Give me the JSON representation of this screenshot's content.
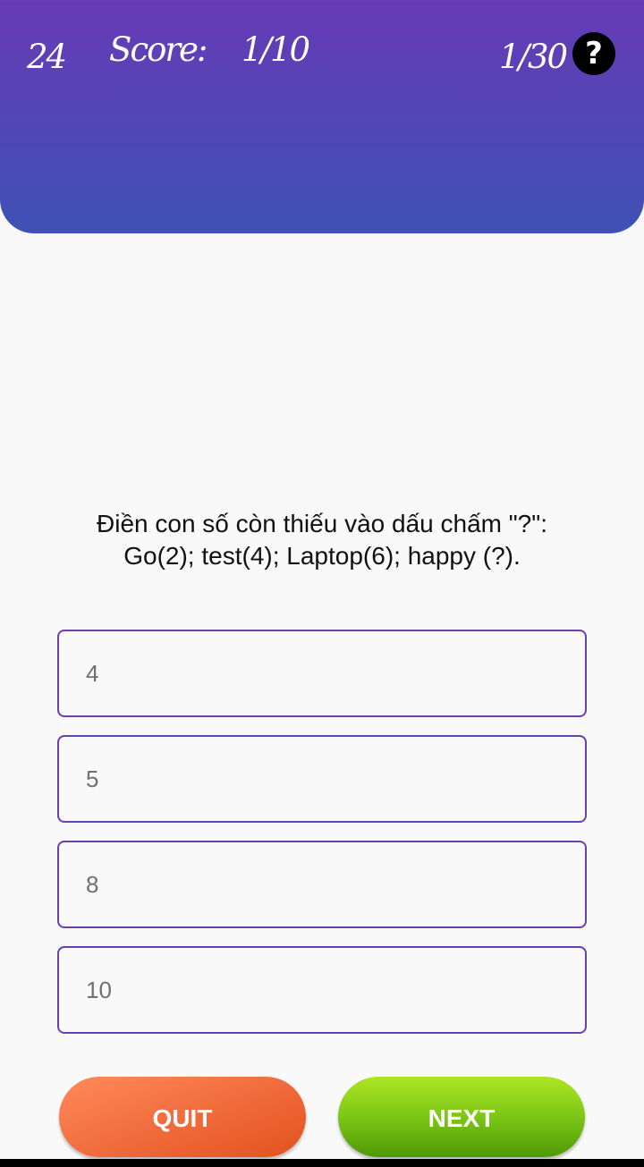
{
  "header": {
    "timer": "24",
    "score_label": "Score:",
    "score_value": "1/10",
    "question_counter": "1/30",
    "help_symbol": "?"
  },
  "question": {
    "line1": "Điền con số còn thiếu vào dấu chấm \"?\":",
    "line2": "Go(2); test(4); Laptop(6); happy (?)."
  },
  "options": [
    {
      "label": "4"
    },
    {
      "label": "5"
    },
    {
      "label": "8"
    },
    {
      "label": "10"
    }
  ],
  "buttons": {
    "quit_label": "QUIT",
    "next_label": "NEXT"
  },
  "colors": {
    "header_top": "#673ab7",
    "header_bottom": "#3f51b5",
    "option_border": "#6a3fb1",
    "quit": "#f06a3a",
    "next": "#7cc616"
  }
}
